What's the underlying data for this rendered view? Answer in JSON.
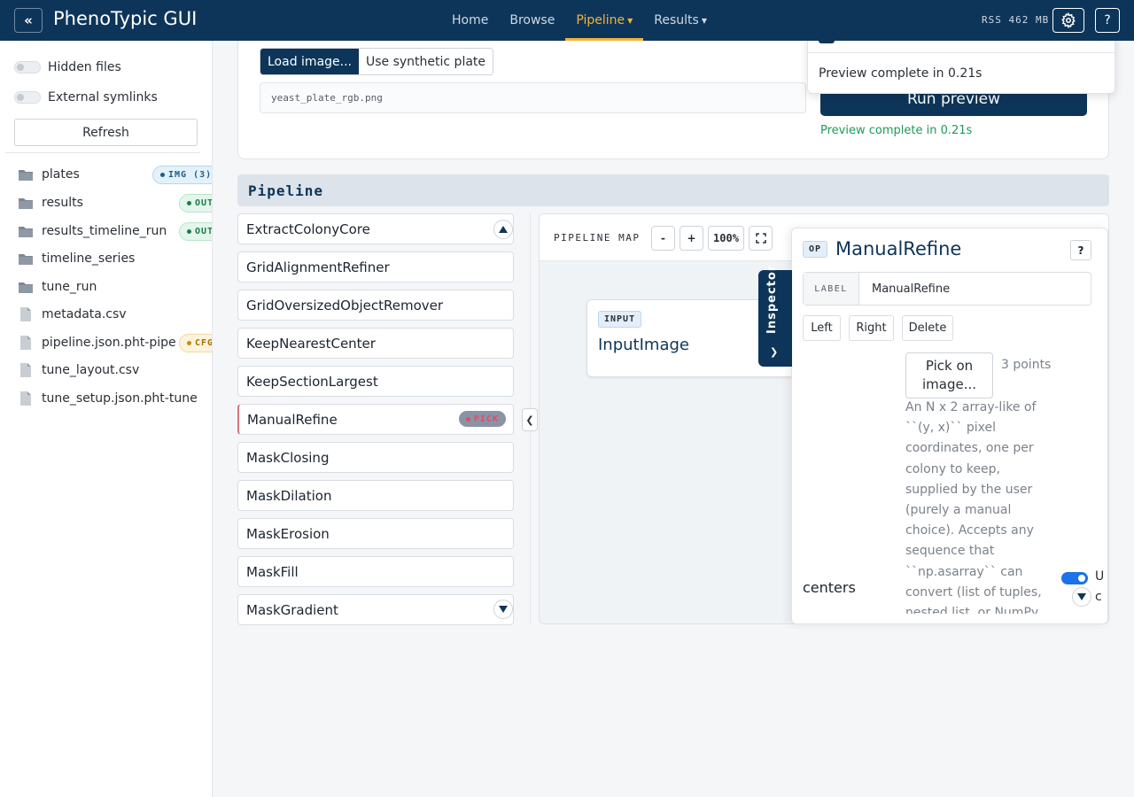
{
  "app": {
    "title": "PhenoTypic GUI",
    "collapse_icon": "«",
    "rss": "RSS 462 MB",
    "help_label": "?"
  },
  "nav": {
    "items": [
      {
        "label": "Home",
        "active": false,
        "dropdown": false
      },
      {
        "label": "Browse",
        "active": false,
        "dropdown": false
      },
      {
        "label": "Pipeline",
        "active": true,
        "dropdown": true
      },
      {
        "label": "Results",
        "active": false,
        "dropdown": true
      }
    ],
    "accent": "#f5b335"
  },
  "sidebar": {
    "hidden_files_label": "Hidden files",
    "external_symlinks_label": "External symlinks",
    "refresh_label": "Refresh",
    "files": [
      {
        "name": "plates",
        "type": "folder",
        "badge": "IMG (3)",
        "badge_kind": "img"
      },
      {
        "name": "results",
        "type": "folder",
        "badge": "OUT",
        "badge_kind": "out"
      },
      {
        "name": "results_timeline_run",
        "type": "folder",
        "badge": "OUT",
        "badge_kind": "out"
      },
      {
        "name": "timeline_series",
        "type": "folder",
        "badge": "",
        "badge_kind": ""
      },
      {
        "name": "tune_run",
        "type": "folder",
        "badge": "",
        "badge_kind": ""
      },
      {
        "name": "metadata.csv",
        "type": "file",
        "badge": "",
        "badge_kind": ""
      },
      {
        "name": "pipeline.json.pht-pipe",
        "type": "file",
        "badge": "CFG",
        "badge_kind": "cfg"
      },
      {
        "name": "tune_layout.csv",
        "type": "file",
        "badge": "",
        "badge_kind": ""
      },
      {
        "name": "tune_setup.json.pht-tune",
        "type": "file",
        "badge": "",
        "badge_kind": ""
      }
    ]
  },
  "preview": {
    "load_image_label": "Load image...",
    "synthetic_label": "Use synthetic plate",
    "file_value": "yeast_plate_rgb.png",
    "run_label": "Run preview",
    "status": "Preview complete in 0.21s",
    "toast_message": "Preview complete in 0.21s"
  },
  "pipeline": {
    "title": "Pipeline",
    "operations": [
      {
        "name": "ExtractColonyCore",
        "badge": ""
      },
      {
        "name": "GridAlignmentRefiner",
        "badge": ""
      },
      {
        "name": "GridOversizedObjectRemover",
        "badge": ""
      },
      {
        "name": "KeepNearestCenter",
        "badge": ""
      },
      {
        "name": "KeepSectionLargest",
        "badge": ""
      },
      {
        "name": "ManualRefine",
        "badge": "PICK",
        "selected": true
      },
      {
        "name": "MaskClosing",
        "badge": ""
      },
      {
        "name": "MaskDilation",
        "badge": ""
      },
      {
        "name": "MaskErosion",
        "badge": ""
      },
      {
        "name": "MaskFill",
        "badge": ""
      },
      {
        "name": "MaskGradient",
        "badge": ""
      }
    ],
    "split_toggle": "❮"
  },
  "map": {
    "title": "PIPELINE MAP",
    "zoom_out": "-",
    "zoom_in": "+",
    "zoom_level": "100%",
    "node": {
      "tag": "INPUT",
      "title": "InputImage"
    },
    "inspector_tab": "Inspector"
  },
  "inspector": {
    "tag": "OP",
    "title": "ManualRefine",
    "help": "?",
    "label_caption": "LABEL",
    "label_value": "ManualRefine",
    "actions": [
      "Left",
      "Right",
      "Delete"
    ],
    "pick_label": "Pick on image...",
    "points_text": "3 points",
    "description": "An N x 2 array-like of ``(y, x)`` pixel coordinates, one per colony to keep, supplied by the user (purely a manual choice). Accepts any sequence that ``np.asarray`` can convert (list of tuples, nested list, or NumPy",
    "param_name": "centers",
    "toggle_on": true,
    "cut_text_1": "U",
    "cut_text_2": "c"
  }
}
